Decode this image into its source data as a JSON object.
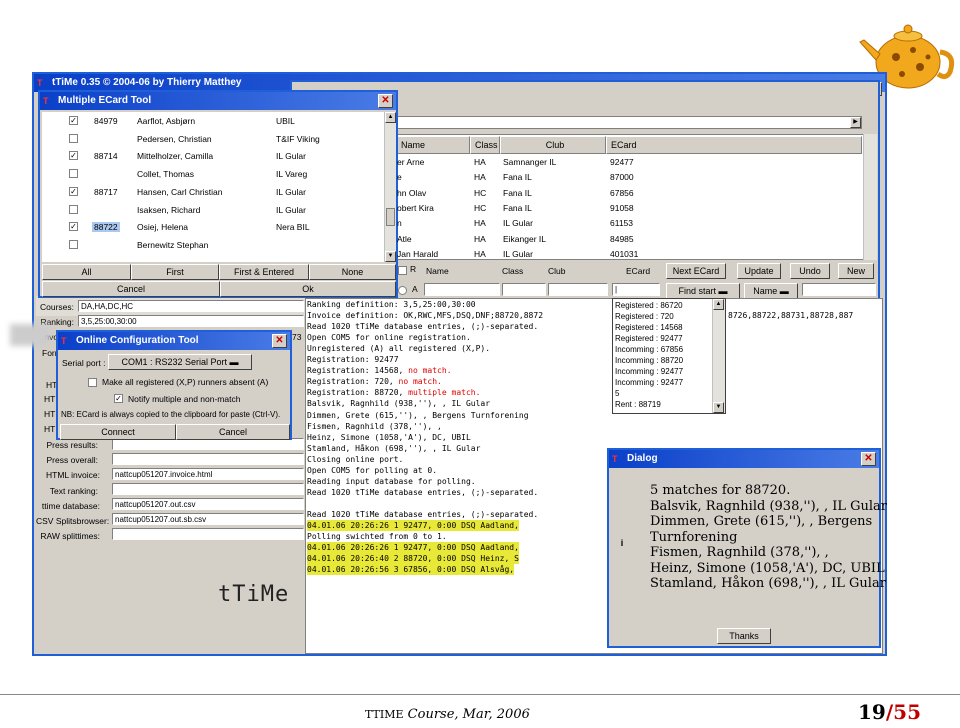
{
  "main_window": {
    "title": "tTiMe 0.35 © 2004-06 by Thierry Matthey"
  },
  "ecard_tool": {
    "title": "Multiple ECard Tool",
    "rows": [
      {
        "checked": true,
        "ecard": "84979",
        "name": "Aarflot, Asbjørn",
        "club": "UBIL"
      },
      {
        "checked": false,
        "ecard": "",
        "name": "Pedersen, Christian",
        "club": "T&IF Viking"
      },
      {
        "checked": true,
        "ecard": "88714",
        "name": "Mittelholzer, Camilla",
        "club": "IL Gular"
      },
      {
        "checked": false,
        "ecard": "",
        "name": "Collet, Thomas",
        "club": "IL Vareg"
      },
      {
        "checked": true,
        "ecard": "88717",
        "name": "Hansen, Carl Christian",
        "club": "IL Gular"
      },
      {
        "checked": false,
        "ecard": "",
        "name": "Isaksen, Richard",
        "club": "IL Gular"
      },
      {
        "checked": true,
        "ecard": "88722",
        "name": "Osiej, Helena",
        "club": "Nera BIL"
      },
      {
        "checked": false,
        "ecard": "",
        "name": "Bernewitz Stephan",
        "club": ""
      }
    ],
    "buttons": {
      "all": "All",
      "first": "First",
      "first_entered": "First & Entered",
      "none": "None",
      "cancel": "Cancel",
      "ok": "Ok"
    }
  },
  "runner_table": {
    "headers": [
      "Name",
      "Class",
      "Club",
      "ECard"
    ],
    "rows": [
      {
        "name": "er Arne",
        "class": "HA",
        "club": "Samnanger IL",
        "ecard": "92477"
      },
      {
        "name": "e",
        "class": "HA",
        "club": "Fana IL",
        "ecard": "87000"
      },
      {
        "name": "hn Olav",
        "class": "HC",
        "club": "Fana IL",
        "ecard": "67856"
      },
      {
        "name": "obert Kira",
        "class": "HC",
        "club": "Fana IL",
        "ecard": "91058"
      },
      {
        "name": "n",
        "class": "HA",
        "club": "IL Gular",
        "ecard": "61153"
      },
      {
        "name": "Atle",
        "class": "HA",
        "club": "Eikanger IL",
        "ecard": "84985"
      },
      {
        "name": "Jan Harald",
        "class": "HA",
        "club": "IL Gular",
        "ecard": "401031"
      }
    ],
    "edit_row": {
      "r_label": "R",
      "name": "Name",
      "class": "Class",
      "club": "Club",
      "ecard": "ECard",
      "next_ecard": "Next ECard",
      "update": "Update",
      "undo": "Undo",
      "new": "New"
    },
    "find_row": {
      "a_label": "A",
      "ecard_value": "|",
      "find_start": "Find start",
      "name_sort": "Name"
    }
  },
  "settings": {
    "courses_label": "Courses:",
    "courses_value": "DA,HA,DC,HC",
    "ranking_label": "Ranking:",
    "ranking_value": "3,5,25:00,30:00",
    "invoice_label": "Invo",
    "invoice_suffix": "73",
    "format_label": "Form",
    "h1": "HTM",
    "h2": "HTM",
    "h3": "HTM",
    "h4": "HTM",
    "press_results_label": "Press results:",
    "press_overall_label": "Press overall:",
    "html_invoice_label": "HTML invoice:",
    "html_invoice_value": "nattcup051207.invoice.html",
    "text_ranking_label": "Text ranking:",
    "ttime_db_label": "ttime database:",
    "ttime_db_value": "nattcup051207.out.csv",
    "csv_split_label": "CSV Splitsbrowser:",
    "csv_split_value": "nattcup051207.out.sb.csv",
    "raw_split_label": "RAW splittimes:"
  },
  "online_config": {
    "title": "Online Configuration Tool",
    "serial_label": "Serial port :",
    "serial_value": "COM1 : RS232 Serial Port",
    "opt1": "Make all registered (X,P) runners absent (A)",
    "opt2": "Notify multiple and non-match",
    "note": "NB: ECard is always copied to the clipboard for paste (Ctrl-V).",
    "connect": "Connect",
    "cancel": "Cancel"
  },
  "log": {
    "lines": [
      {
        "t": "Ranking definition:        3,5,25:00,30:00"
      },
      {
        "t": "Invoice definition:        OK,RWC,MFS,DSQ,DNF;88720,8872",
        "tail": "8726,88722,88731,88728,887"
      },
      {
        "t": "Read 1020 tTiMe database entries, (;)-separated."
      },
      {
        "t": "Open COM5 for online registration."
      },
      {
        "t": "Unregistered (A) all registered (X,P)."
      },
      {
        "t": "Registration:  92477"
      },
      {
        "t": "Registration:  14568, ",
        "red": "no match."
      },
      {
        "t": "Registration:    720, ",
        "red": "no match."
      },
      {
        "t": "Registration:  88720, ",
        "red": "multiple match."
      },
      {
        "t": "Balsvik, Ragnhild (938,''), , IL Gular"
      },
      {
        "t": "Dimmen, Grete (615,''), , Bergens Turnforening"
      },
      {
        "t": "Fismen, Ragnhild (378,''), ,"
      },
      {
        "t": "Heinz, Simone (1058,'A'), DC, UBIL"
      },
      {
        "t": "Stamland, Håkon (698,''), , IL Gular"
      },
      {
        "t": "Closing online port."
      },
      {
        "t": "Open COM5 for polling at 0."
      },
      {
        "t": "Reading input database for polling."
      },
      {
        "t": "Read 1020 tTiMe database entries, (;)-separated."
      },
      {
        "t": ""
      },
      {
        "t": "Read 1020 tTiMe database entries, (;)-separated."
      },
      {
        "t": "04.01.06 20:26:26    1  92477,   0:00   DSQ Aadland,",
        "hl": true
      },
      {
        "t": "Polling swichted from 0 to 1."
      },
      {
        "t": "04.01.06 20:26:26    1  92477,   0:00   DSQ Aadland,",
        "hl": true
      },
      {
        "t": "04.01.06 20:26:40    2  88720,   0:00   DSQ Heinz, S",
        "hl": true
      },
      {
        "t": "04.01.06 20:26:56    3  67856,   0:00   DSQ Alsvåg,",
        "hl": true
      }
    ]
  },
  "registrations": [
    "Registered : 86720",
    "Registered : 720",
    "Registered : 14568",
    "Registered : 92477",
    "Incomming : 67856",
    "Incomming : 88720",
    "Incomming : 92477",
    "Incomming : 92477",
    "5",
    "Rent : 88719"
  ],
  "dialog": {
    "title": "Dialog",
    "lines": [
      "5 matches for 88720.",
      "Balsvik, Ragnhild (938,''), , IL Gular",
      "Dimmen, Grete (615,''), , Bergens",
      "Turnforening",
      "Fismen, Ragnhild (378,''), ,",
      "Heinz, Simone (1058,'A'), DC, UBIL",
      "Stamland, Håkon (698,''), , IL Gular"
    ],
    "thanks": "Thanks"
  },
  "logo_text": "tTiMe",
  "footer": {
    "course": "Course, Mar, 2006",
    "brand": "TTIME",
    "page_current": "19",
    "page_total": "/55"
  },
  "colors": {
    "titlebar": "#0a3fc8",
    "highlight": "#e8e838",
    "error": "#e00000",
    "page_accent": "#c00000"
  }
}
